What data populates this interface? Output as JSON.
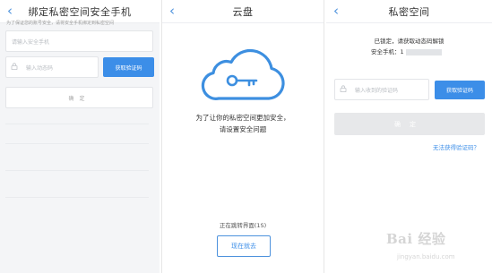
{
  "panel1": {
    "title": "绑定私密空间安全手机",
    "back_icon": "‹",
    "hint": "为了保证您的账号安全，请将安全手机绑定到私密空间",
    "phone_placeholder": "请输入安全手机",
    "code_placeholder": "输入动态码",
    "get_code_label": "获取验证码",
    "confirm_label": "确定"
  },
  "panel2": {
    "title": "云盘",
    "back_icon": "‹",
    "message_line1": "为了让你的私密空间更加安全，",
    "message_line2": "请设置安全问题",
    "redirect_text": "正在跳转界面(1S)",
    "go_button": "现在就去"
  },
  "panel3": {
    "title": "私密空间",
    "back_icon": "‹",
    "locked_text": "已锁定，请获取动态码解锁",
    "phone_label": "安全手机：1",
    "code_placeholder": "输入收到的验证码",
    "get_code_label": "获取验证码",
    "confirm_label": "确定",
    "cant_get_link": "无法获得验证码？"
  },
  "watermark": {
    "main": "Bai 经验",
    "sub": "jingyan.baidu.com"
  },
  "colors": {
    "accent": "#3c8ee8",
    "cloud": "#3d8fe0"
  }
}
